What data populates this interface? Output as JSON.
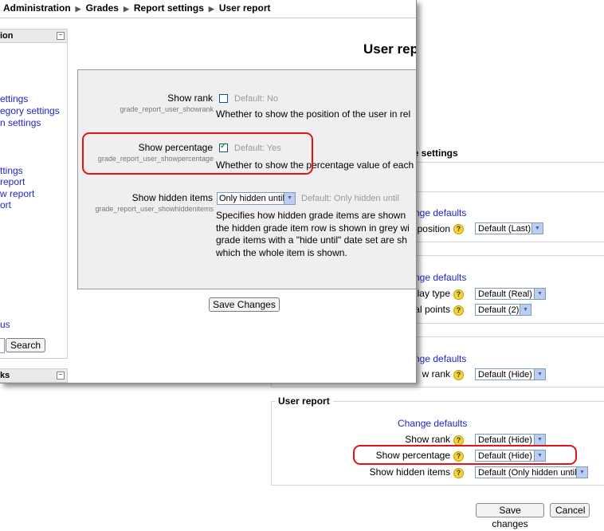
{
  "background": {
    "section_title": "se settings",
    "groups": [
      {
        "link": "nge defaults",
        "rows": [
          {
            "label": "position",
            "value": "Default (Last)"
          }
        ]
      },
      {
        "link": "nge defaults",
        "rows": [
          {
            "label": "lay type",
            "value": "Default (Real)"
          },
          {
            "label": "al points",
            "value": "Default (2)"
          }
        ]
      },
      {
        "link": "nge defaults",
        "rows": [
          {
            "label": "w rank",
            "value": "Default (Hide)"
          }
        ]
      }
    ],
    "user_report": {
      "legend": "User report",
      "link": "Change defaults",
      "rows": [
        {
          "label": "Show rank",
          "value": "Default (Hide)"
        },
        {
          "label": "Show percentage",
          "value": "Default (Hide)"
        },
        {
          "label": "Show hidden items",
          "value": "Default (Only hidden until)"
        }
      ]
    },
    "save_label": "Save changes",
    "cancel_label": "Cancel"
  },
  "foreground": {
    "breadcrumb": [
      "Administration",
      "Grades",
      "Report settings",
      "User report"
    ],
    "page_title": "User rep",
    "sidebar": {
      "block1_title": "ion",
      "links": [
        "ettings",
        "egory settings",
        "n settings",
        "ttings",
        "report",
        "w report",
        "ort",
        "us"
      ],
      "search_label": "Search",
      "block2_title": "ks"
    },
    "settings": [
      {
        "name": "Show rank",
        "key": "grade_report_user_showrank",
        "type": "checkbox",
        "checked": false,
        "default": "Default: No",
        "desc": [
          "Whether to show the position of the user in rel"
        ]
      },
      {
        "name": "Show percentage",
        "key": "grade_report_user_showpercentage",
        "type": "checkbox",
        "checked": true,
        "default": "Default: Yes",
        "desc": [
          "Whether to show the percentage value of each"
        ]
      },
      {
        "name": "Show hidden items",
        "key": "grade_report_user_showhiddenitems",
        "type": "select",
        "value": "Only hidden until",
        "default": "Default: Only hidden until",
        "desc": [
          "Specifies how hidden grade items are shown",
          "the hidden grade item row is shown in grey wi",
          "grade items with a \"hide until\" date set are sh",
          "which the whole item is shown."
        ]
      }
    ],
    "save_label": "Save Changes"
  },
  "icons": {
    "help": "?",
    "dropdown": "▼",
    "collapse": "−",
    "breadcrumb_sep": "▶"
  },
  "colors": {
    "highlight": "#e0141e",
    "link": "#2323c8"
  }
}
